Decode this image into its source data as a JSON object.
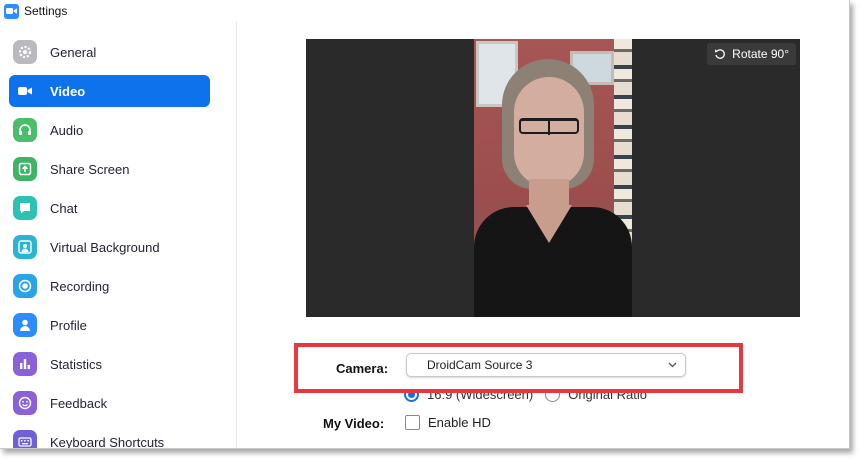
{
  "window": {
    "title": "Settings",
    "app_icon": "video-camera-icon",
    "accent": "#0e72ed"
  },
  "sidebar": {
    "items": [
      {
        "label": "General",
        "icon": "gear-icon",
        "color": "#b9b9bf",
        "active": false
      },
      {
        "label": "Video",
        "icon": "video-camera-icon",
        "color": "#ffffff",
        "active": true
      },
      {
        "label": "Audio",
        "icon": "headphones-icon",
        "color": "#4bbd6b",
        "active": false
      },
      {
        "label": "Share Screen",
        "icon": "share-screen-icon",
        "color": "#3fb465",
        "active": false
      },
      {
        "label": "Chat",
        "icon": "chat-bubble-icon",
        "color": "#2bc2b4",
        "active": false
      },
      {
        "label": "Virtual Background",
        "icon": "person-icon",
        "color": "#2bb4d4",
        "active": false
      },
      {
        "label": "Recording",
        "icon": "record-icon",
        "color": "#2ba3e8",
        "active": false
      },
      {
        "label": "Profile",
        "icon": "profile-icon",
        "color": "#2d8cff",
        "active": false
      },
      {
        "label": "Statistics",
        "icon": "bar-chart-icon",
        "color": "#8b61d8",
        "active": false
      },
      {
        "label": "Feedback",
        "icon": "smiley-icon",
        "color": "#8b61d8",
        "active": false
      },
      {
        "label": "Keyboard Shortcuts",
        "icon": "keyboard-icon",
        "color": "#6e61d8",
        "active": false
      }
    ]
  },
  "preview": {
    "rotate_label": "Rotate 90°",
    "rotate_icon": "rotate-icon"
  },
  "camera": {
    "label": "Camera:",
    "selected": "DroidCam Source 3",
    "highlight_color": "#e8373f"
  },
  "ratio": {
    "option1": "16:9 (Widescreen)",
    "option2": "Original Ratio",
    "selected": "16:9 (Widescreen)"
  },
  "my_video": {
    "label": "My Video:",
    "enable_hd": "Enable HD",
    "enable_hd_checked": false
  }
}
